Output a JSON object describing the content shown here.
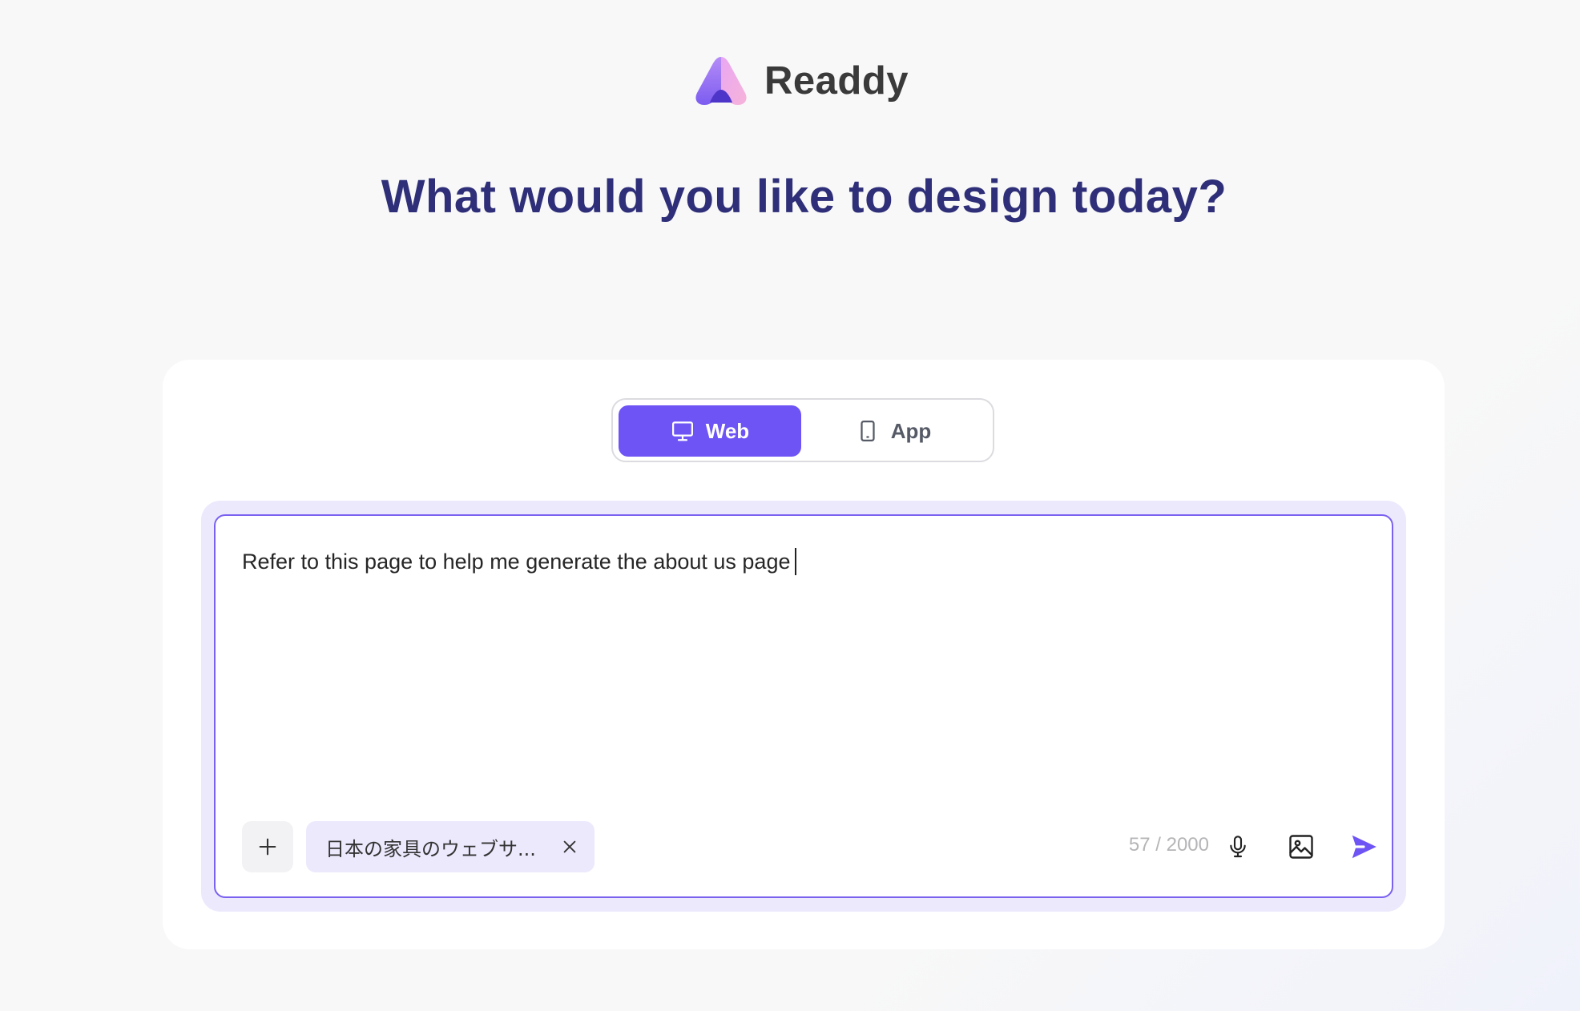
{
  "brand": {
    "name": "Readdy"
  },
  "headline": "What would you like to design today?",
  "mode_toggle": {
    "options": [
      {
        "label": "Web",
        "icon": "monitor-icon",
        "selected": true
      },
      {
        "label": "App",
        "icon": "smartphone-icon",
        "selected": false
      }
    ]
  },
  "prompt": {
    "text": "Refer to this page to help me generate the about us page",
    "attachment_label": "日本の家具のウェブサ...",
    "counter": "57 / 2000",
    "char_count": 57,
    "char_limit": 2000
  },
  "colors": {
    "accent": "#6e53f5",
    "headline": "#2e2f78",
    "chip_bg": "#ece9fd",
    "border_accent": "#7b61f0"
  },
  "icons": [
    "logo-icon",
    "monitor-icon",
    "smartphone-icon",
    "plus-icon",
    "close-icon",
    "microphone-icon",
    "image-icon",
    "send-icon"
  ]
}
